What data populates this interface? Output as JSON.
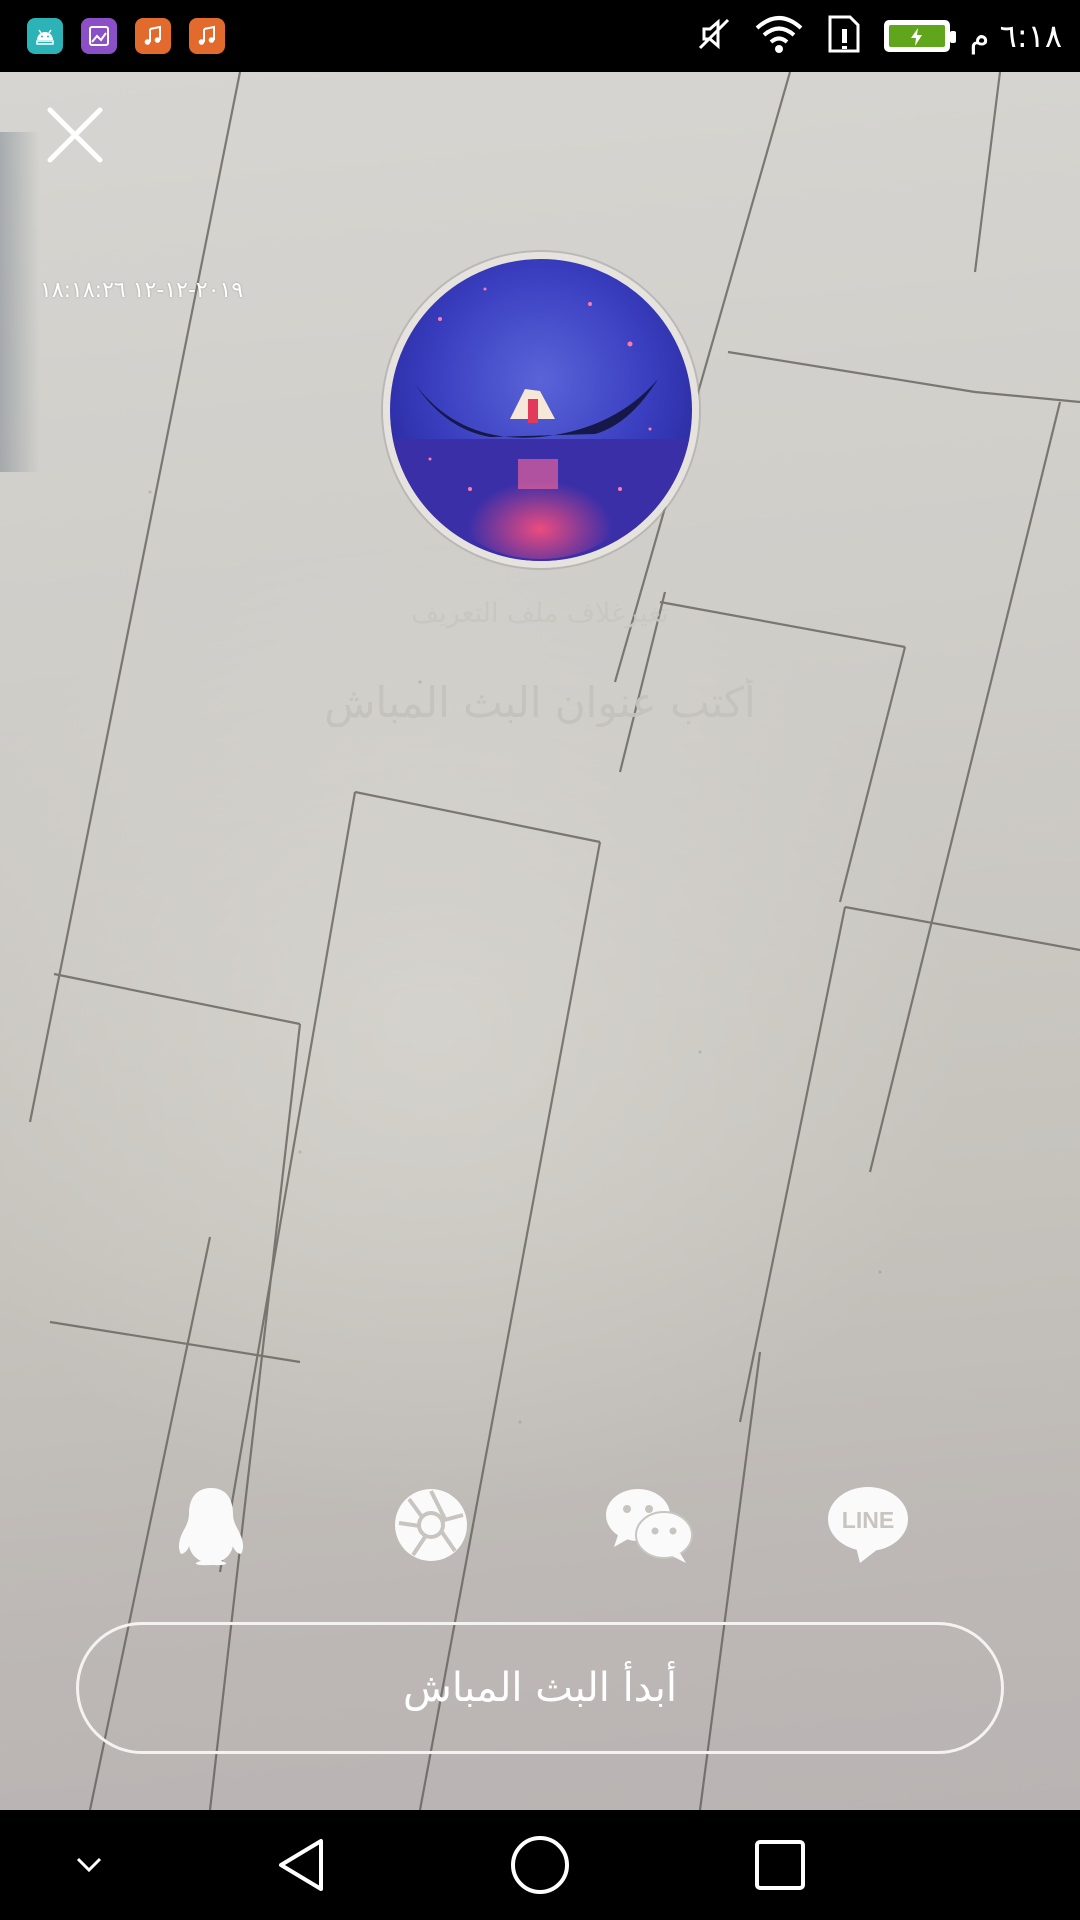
{
  "status_bar": {
    "time": "٦:١٨ م",
    "notification_icons": [
      "android-icon",
      "gallery-icon",
      "music-icon",
      "music-icon"
    ],
    "system_icons": [
      "mute-icon",
      "wifi-icon",
      "sim-icon",
      "battery-charging-icon"
    ],
    "battery_color": "#5fa61c"
  },
  "overlay": {
    "timestamp": "٢٠١٩-١٢-١٢ ١٨:١٨:٢٦",
    "change_cover_label": "تغيرغلاف ملف التعريف",
    "title_placeholder": "أكتب عنوان البث المباش"
  },
  "share": {
    "items": [
      "qq-icon",
      "moments-icon",
      "wechat-icon",
      "line-icon"
    ],
    "line_text": "LINE"
  },
  "start_button": {
    "label": "أبدأ البث المباش"
  },
  "nav_bar": {
    "buttons": [
      "chevron-down-icon",
      "back-icon",
      "home-icon",
      "recents-icon"
    ]
  },
  "colors": {
    "accent": "#ffffff",
    "avatar_bg": "#3a3fc0"
  }
}
